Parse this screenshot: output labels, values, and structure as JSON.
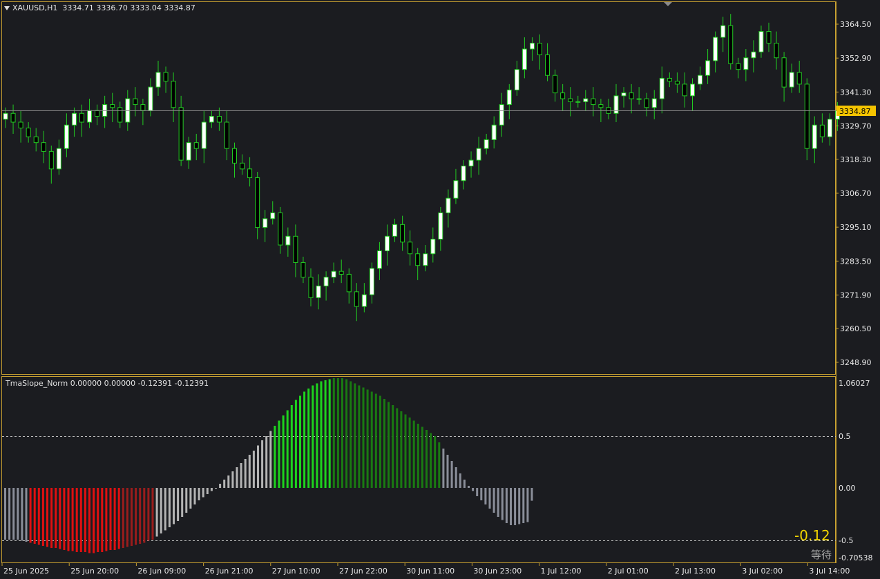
{
  "colors": {
    "background": "#1b1c20",
    "frame": "#c8a030",
    "axis_text": "#e8e8e8",
    "candle_up_body": "#ffffff",
    "candle_wick": "#22cc22",
    "price_line": "#8a8a8a",
    "price_tag_bg": "#f5c400",
    "hist_red": "#e01010",
    "hist_darkred": "#9a1c1c",
    "hist_grey": "#8a8e99",
    "hist_lightgrey": "#b4b4b4",
    "hist_green": "#1ed31e",
    "hist_darkgreen": "#1a7a12"
  },
  "main_chart": {
    "symbol_header": "XAUUSD,H1",
    "ohlc": "3334.71 3336.70 3333.04 3334.87",
    "price_labels": [
      "3364.50",
      "3352.90",
      "3341.30",
      "3329.70",
      "3318.30",
      "3306.70",
      "3295.10",
      "3283.50",
      "3271.90",
      "3260.50",
      "3248.90"
    ],
    "current_price": "3334.87"
  },
  "indicator": {
    "header": "TmaSlope_Norm 0.00000 0.00000 -0.12391 -0.12391",
    "levels": [
      "1.06027",
      "0.5",
      "0.00",
      "-0.5",
      "-0.70538"
    ],
    "current_value": "-0.12",
    "status": "等待"
  },
  "time_axis": [
    "25 Jun 2025",
    "25 Jun 20:00",
    "26 Jun 09:00",
    "26 Jun 21:00",
    "27 Jun 10:00",
    "27 Jun 22:00",
    "30 Jun 11:00",
    "30 Jun 23:00",
    "1 Jul 12:00",
    "2 Jul 01:00",
    "2 Jul 13:00",
    "3 Jul 02:00",
    "3 Jul 14:00"
  ],
  "chart_data": [
    {
      "type": "candlestick",
      "title": "XAUUSD,H1",
      "ylim": [
        3244,
        3369
      ],
      "closes": [
        3334,
        3331,
        3329,
        3326,
        3324,
        3321,
        3315,
        3322,
        3330,
        3334,
        3331,
        3335,
        3333,
        3337,
        3336,
        3331,
        3339,
        3337,
        3335,
        3343,
        3348,
        3345,
        3336,
        3318,
        3324,
        3322,
        3331,
        3333,
        3331,
        3322,
        3317,
        3315,
        3312,
        3295,
        3298,
        3300,
        3289,
        3292,
        3283,
        3278,
        3271,
        3275,
        3278,
        3280,
        3279,
        3273,
        3268,
        3272,
        3281,
        3287,
        3292,
        3296,
        3290,
        3286,
        3282,
        3286,
        3291,
        3300,
        3305,
        3311,
        3316,
        3318,
        3322,
        3325,
        3330,
        3337,
        3342,
        3349,
        3356,
        3358,
        3354,
        3347,
        3341,
        3339,
        3338,
        3338,
        3339,
        3337,
        3336,
        3334,
        3340,
        3341,
        3339,
        3339,
        3336,
        3339,
        3346,
        3345,
        3344,
        3340,
        3344,
        3347,
        3352,
        3360,
        3364,
        3351,
        3349,
        3353,
        3355,
        3362,
        3358,
        3353,
        3343,
        3348,
        3344,
        3322,
        3330,
        3326,
        3332,
        3334.87
      ]
    },
    {
      "type": "bar",
      "title": "TmaSlope_Norm",
      "ylim": [
        -0.70538,
        1.06027
      ],
      "levels": [
        0.5,
        -0.5
      ],
      "values": [
        -0.5,
        -0.5,
        -0.5,
        -0.5,
        -0.51,
        -0.52,
        -0.53,
        -0.54,
        -0.55,
        -0.56,
        -0.57,
        -0.58,
        -0.58,
        -0.59,
        -0.6,
        -0.61,
        -0.61,
        -0.62,
        -0.62,
        -0.62,
        -0.63,
        -0.63,
        -0.62,
        -0.62,
        -0.61,
        -0.6,
        -0.6,
        -0.59,
        -0.58,
        -0.57,
        -0.56,
        -0.55,
        -0.54,
        -0.53,
        -0.51,
        -0.5,
        -0.47,
        -0.44,
        -0.41,
        -0.38,
        -0.35,
        -0.32,
        -0.28,
        -0.24,
        -0.2,
        -0.16,
        -0.12,
        -0.09,
        -0.06,
        -0.03,
        0,
        0.04,
        0.08,
        0.12,
        0.16,
        0.2,
        0.24,
        0.28,
        0.32,
        0.36,
        0.41,
        0.46,
        0.5,
        0.55,
        0.6,
        0.65,
        0.7,
        0.75,
        0.8,
        0.85,
        0.89,
        0.93,
        0.96,
        0.99,
        1.01,
        1.03,
        1.04,
        1.05,
        1.06,
        1.06,
        1.06,
        1.05,
        1.03,
        1.01,
        0.99,
        0.97,
        0.95,
        0.93,
        0.91,
        0.89,
        0.86,
        0.83,
        0.8,
        0.77,
        0.74,
        0.71,
        0.68,
        0.65,
        0.62,
        0.59,
        0.56,
        0.53,
        0.5,
        0.44,
        0.38,
        0.32,
        0.26,
        0.2,
        0.14,
        0.08,
        0.02,
        -0.03,
        -0.08,
        -0.12,
        -0.16,
        -0.2,
        -0.24,
        -0.28,
        -0.31,
        -0.34,
        -0.36,
        -0.36,
        -0.35,
        -0.34,
        -0.33,
        -0.12391
      ]
    }
  ]
}
